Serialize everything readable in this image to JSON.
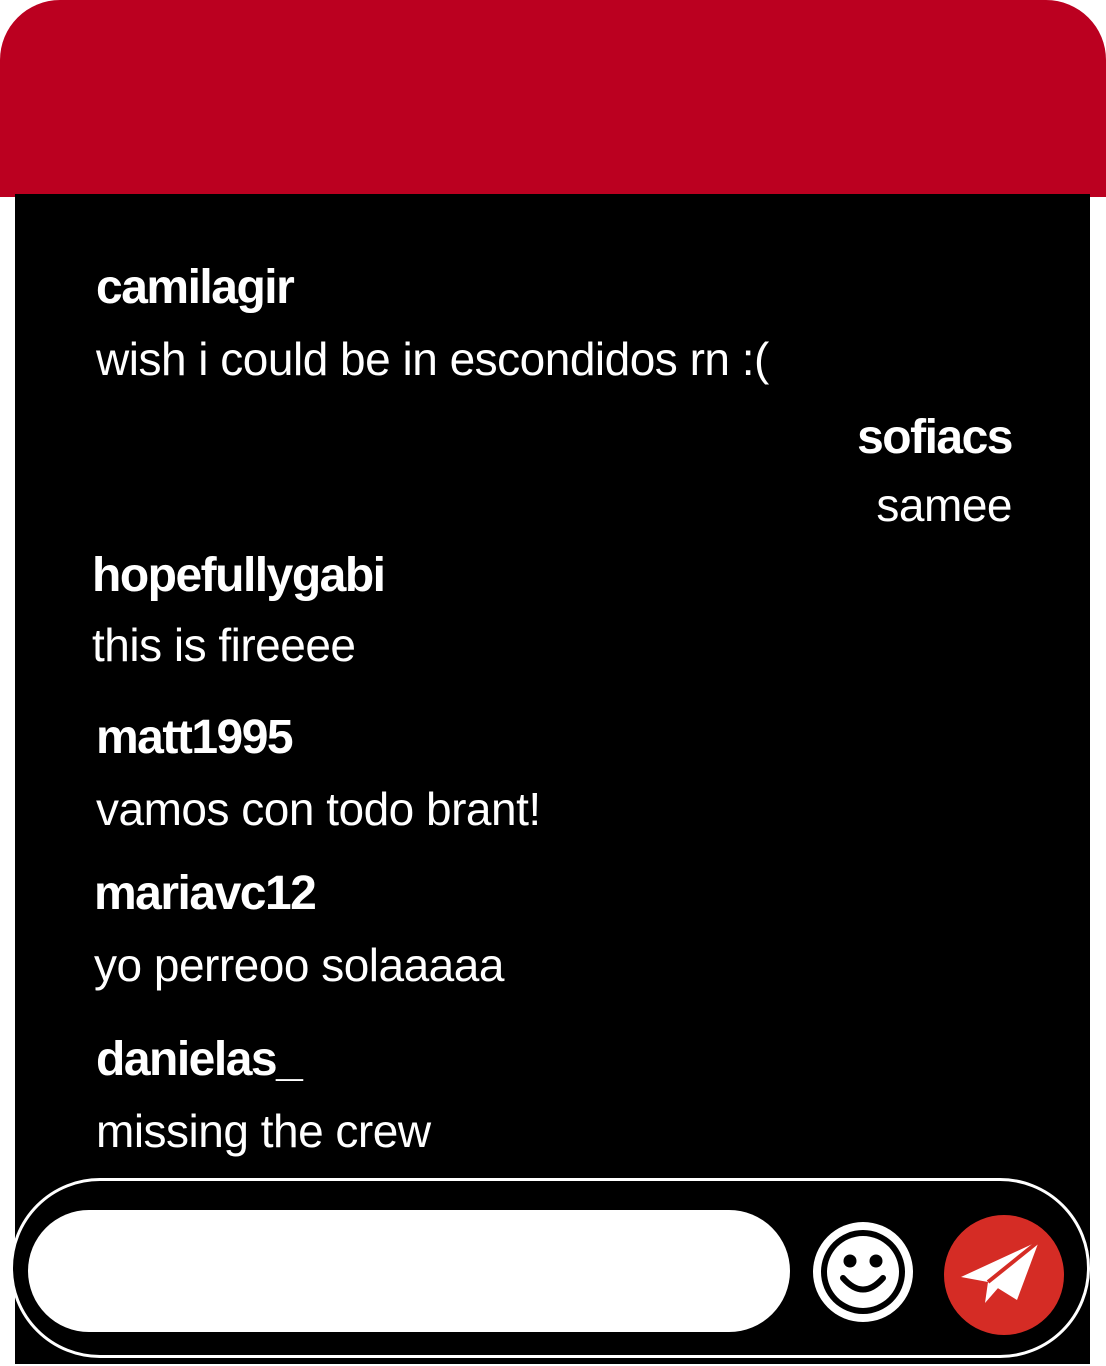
{
  "colors": {
    "header": "#bb0020",
    "background": "#000000",
    "text": "#ffffff",
    "send_button": "#d52c25"
  },
  "messages": [
    {
      "user": "camilagir",
      "text": "wish i could be in escondidos rn :("
    },
    {
      "user": "sofiacs",
      "text": "samee"
    },
    {
      "user": "hopefullygabi",
      "text": "this is fireeee"
    },
    {
      "user": "matt1995",
      "text": "vamos con todo brant!"
    },
    {
      "user": "mariavc12",
      "text": "yo perreoo solaaaaa"
    },
    {
      "user": "danielas_",
      "text": "missing the crew"
    }
  ],
  "composer": {
    "input_value": "",
    "emoji_icon": "smiley-face-icon",
    "send_icon": "paper-plane-icon"
  }
}
